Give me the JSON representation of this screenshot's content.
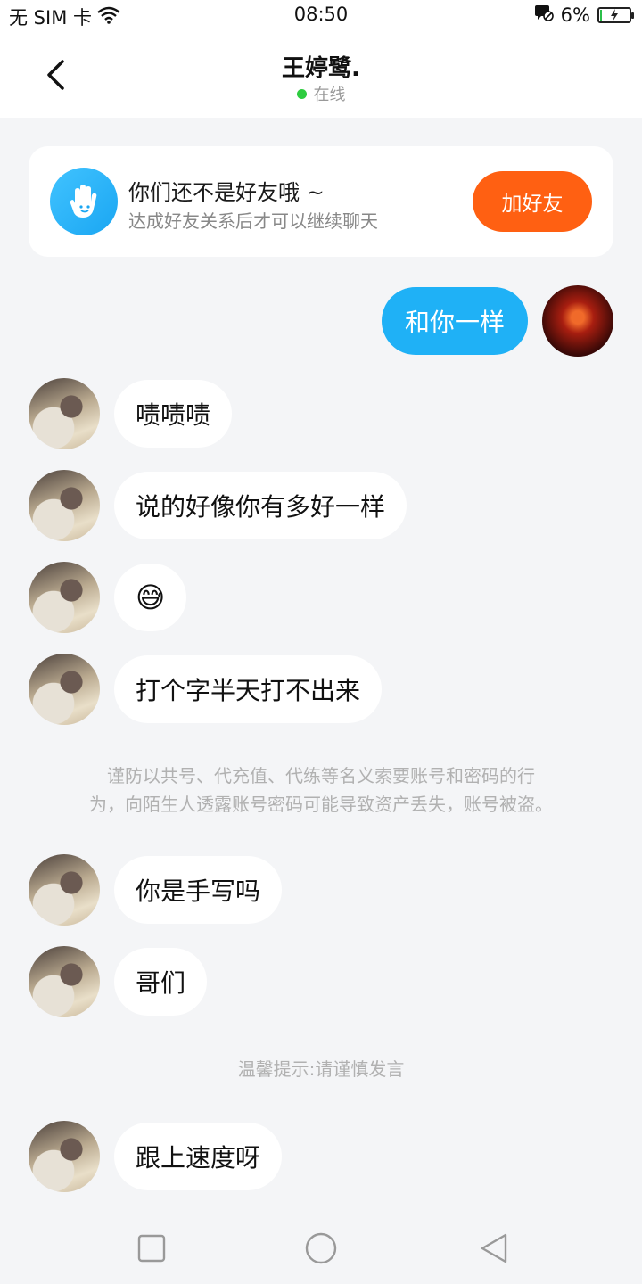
{
  "status_bar": {
    "sim": "无 SIM 卡",
    "time": "08:50",
    "battery": "6%",
    "battery_level": 0.06
  },
  "header": {
    "title": "王婷鹭.",
    "status": "在线"
  },
  "friend_card": {
    "title": "你们还不是好友哦 ~",
    "subtitle": "达成好友关系后才可以继续聊天",
    "button": "加好友"
  },
  "messages": {
    "m0": "和你一样",
    "m1": "啧啧啧",
    "m2": "说的好像你有多好一样",
    "m3": "😅",
    "m4": "打个字半天打不出来",
    "m5": "你是手写吗",
    "m6": "哥们",
    "m7": "跟上速度呀"
  },
  "notices": {
    "warning_line1": "谨防以共号、代充值、代练等名义索要账号和密码的行",
    "warning_line2": "为，向陌生人透露账号密码可能导致资产丢失，账号被盗。",
    "tip": "温馨提示:请谨慎发言"
  },
  "colors": {
    "accent_blue": "#1fb1f6",
    "add_friend_orange": "#ff6012",
    "online_green": "#2ecc40"
  },
  "icons": {
    "back": "chevron-left-icon",
    "card": "hand-icon",
    "nav": [
      "square-icon",
      "circle-icon",
      "triangle-back-icon"
    ]
  }
}
